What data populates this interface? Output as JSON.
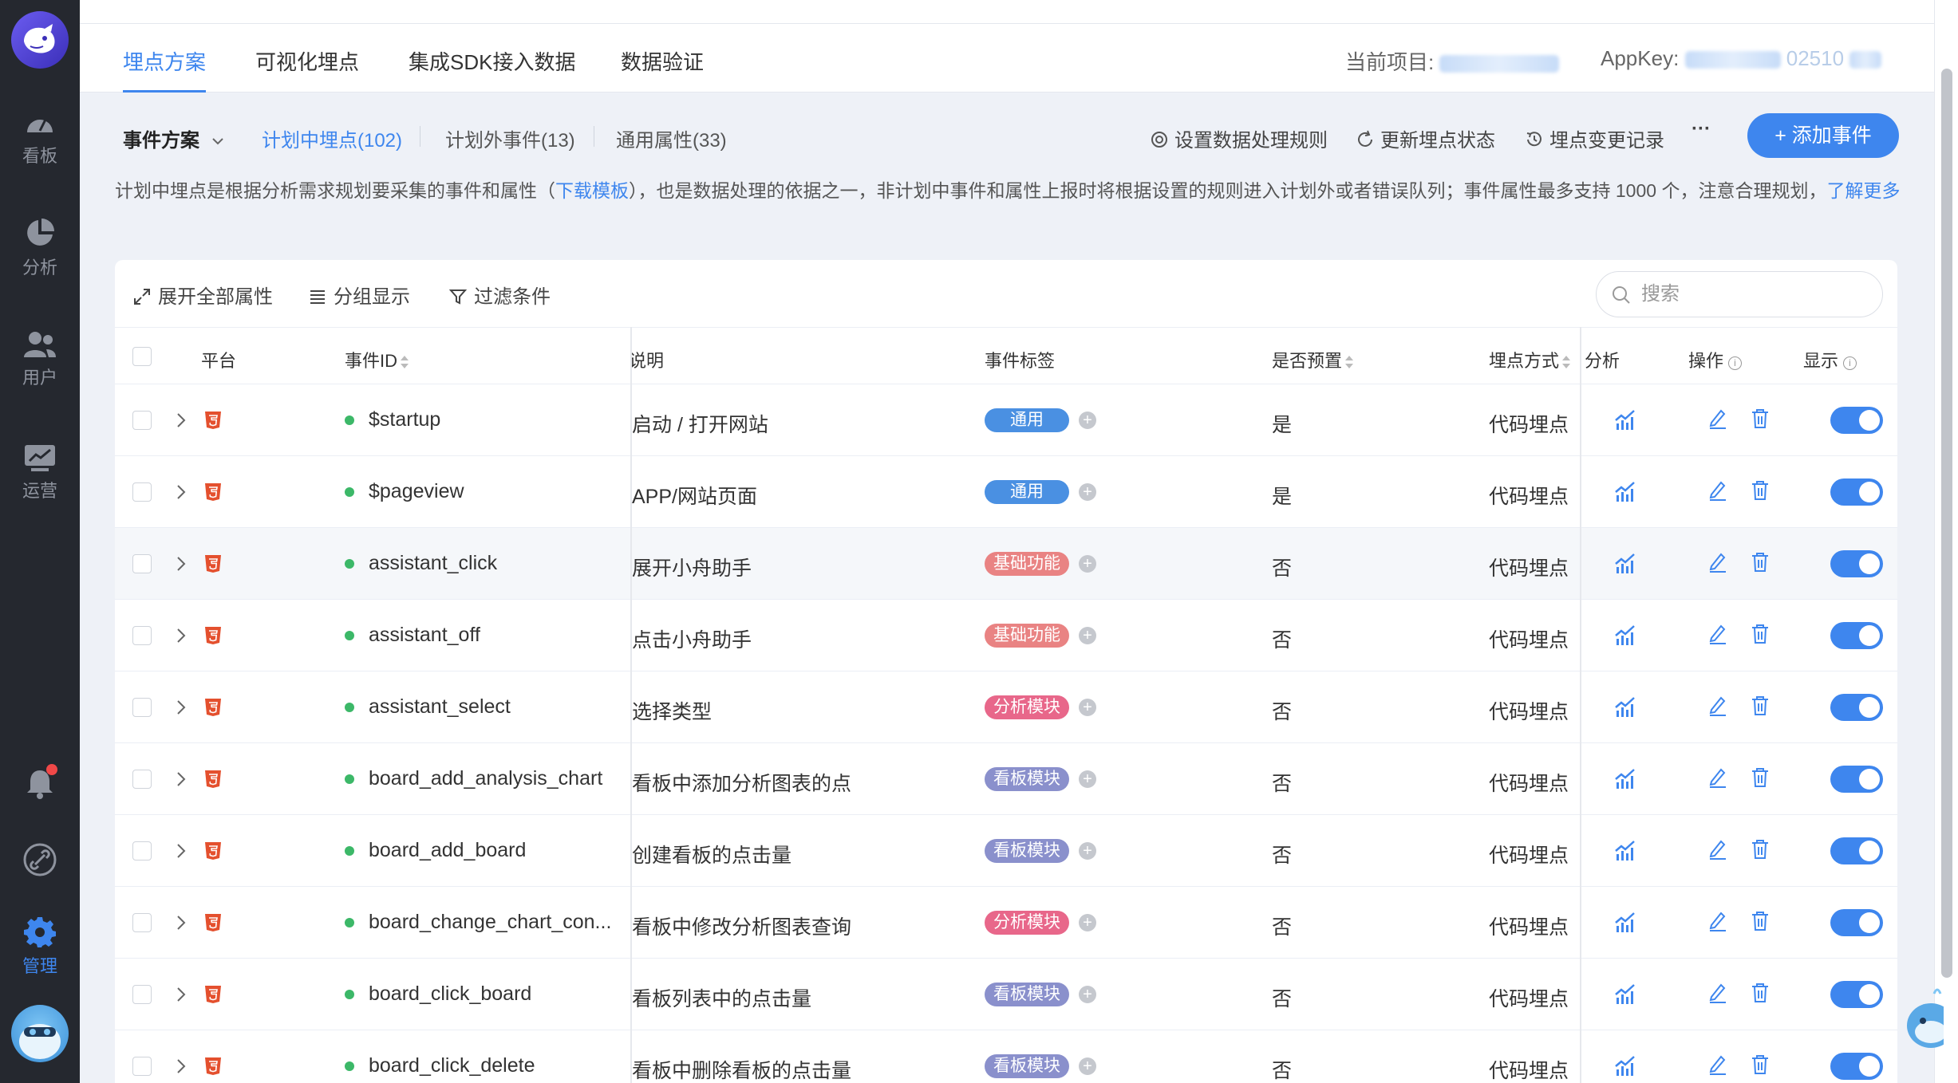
{
  "sidebar": {
    "items": [
      {
        "label": "看板",
        "icon": "dashboard-gauge-icon"
      },
      {
        "label": "分析",
        "icon": "pie-chart-icon"
      },
      {
        "label": "用户",
        "icon": "users-icon"
      },
      {
        "label": "运营",
        "icon": "monitor-chart-icon"
      },
      {
        "label": "管理",
        "icon": "gear-icon",
        "active": true
      }
    ]
  },
  "header": {
    "tabs": [
      "埋点方案",
      "可视化埋点",
      "集成SDK接入数据",
      "数据验证"
    ],
    "project_label": "当前项目:",
    "appkey_label": "AppKey:",
    "appkey_suffix": "02510"
  },
  "subbar": {
    "scheme": "事件方案",
    "tabs": [
      "计划中埋点(102)",
      "计划外事件(13)",
      "通用属性(33)"
    ],
    "tools": [
      "设置数据处理规则",
      "更新埋点状态",
      "埋点变更记录"
    ],
    "more": "···",
    "add_button": "+ 添加事件"
  },
  "description": {
    "before": "计划中埋点是根据分析需求规划要采集的事件和属性（",
    "link": "下载模板",
    "after": "），也是数据处理的依据之一，非计划中事件和属性上报时将根据设置的规则进入计划外或者错误队列；事件属性最多支持 1000 个，注意合理规划，",
    "more_link": "了解更多"
  },
  "table_tools": [
    "展开全部属性",
    "分组显示",
    "过滤条件"
  ],
  "search": {
    "placeholder": "搜索"
  },
  "columns": [
    "平台",
    "事件ID",
    "说明",
    "事件标签",
    "是否预置",
    "埋点方式",
    "分析",
    "操作",
    "显示"
  ],
  "rows": [
    {
      "id": "$startup",
      "desc": "启动 / 打开网站",
      "tag": "通用",
      "tag_color": "#4a90e2",
      "preset": "是",
      "method": "代码埋点"
    },
    {
      "id": "$pageview",
      "desc": "APP/网站页面",
      "tag": "通用",
      "tag_color": "#4a90e2",
      "preset": "是",
      "method": "代码埋点"
    },
    {
      "id": "assistant_click",
      "desc": "展开小舟助手",
      "tag": "基础功能",
      "tag_color": "#e98383",
      "preset": "否",
      "method": "代码埋点"
    },
    {
      "id": "assistant_off",
      "desc": "点击小舟助手",
      "tag": "基础功能",
      "tag_color": "#e98383",
      "preset": "否",
      "method": "代码埋点"
    },
    {
      "id": "assistant_select",
      "desc": "选择类型",
      "tag": "分析模块",
      "tag_color": "#e8678a",
      "preset": "否",
      "method": "代码埋点"
    },
    {
      "id": "board_add_analysis_chart",
      "desc": "看板中添加分析图表的点",
      "tag": "看板模块",
      "tag_color": "#8a90cc",
      "preset": "否",
      "method": "代码埋点"
    },
    {
      "id": "board_add_board",
      "desc": "创建看板的点击量",
      "tag": "看板模块",
      "tag_color": "#8a90cc",
      "preset": "否",
      "method": "代码埋点"
    },
    {
      "id": "board_change_chart_con...",
      "desc": "看板中修改分析图表查询",
      "tag": "分析模块",
      "tag_color": "#e8678a",
      "preset": "否",
      "method": "代码埋点"
    },
    {
      "id": "board_click_board",
      "desc": "看板列表中的点击量",
      "tag": "看板模块",
      "tag_color": "#8a90cc",
      "preset": "否",
      "method": "代码埋点"
    },
    {
      "id": "board_click_delete",
      "desc": "看板中删除看板的点击量",
      "tag": "看板模块",
      "tag_color": "#8a90cc",
      "preset": "否",
      "method": "代码埋点"
    }
  ],
  "colors": {
    "accent": "#3e86ee",
    "sidebar": "#25282f",
    "online_dot": "#3cb868",
    "html5": "#e4502e"
  }
}
